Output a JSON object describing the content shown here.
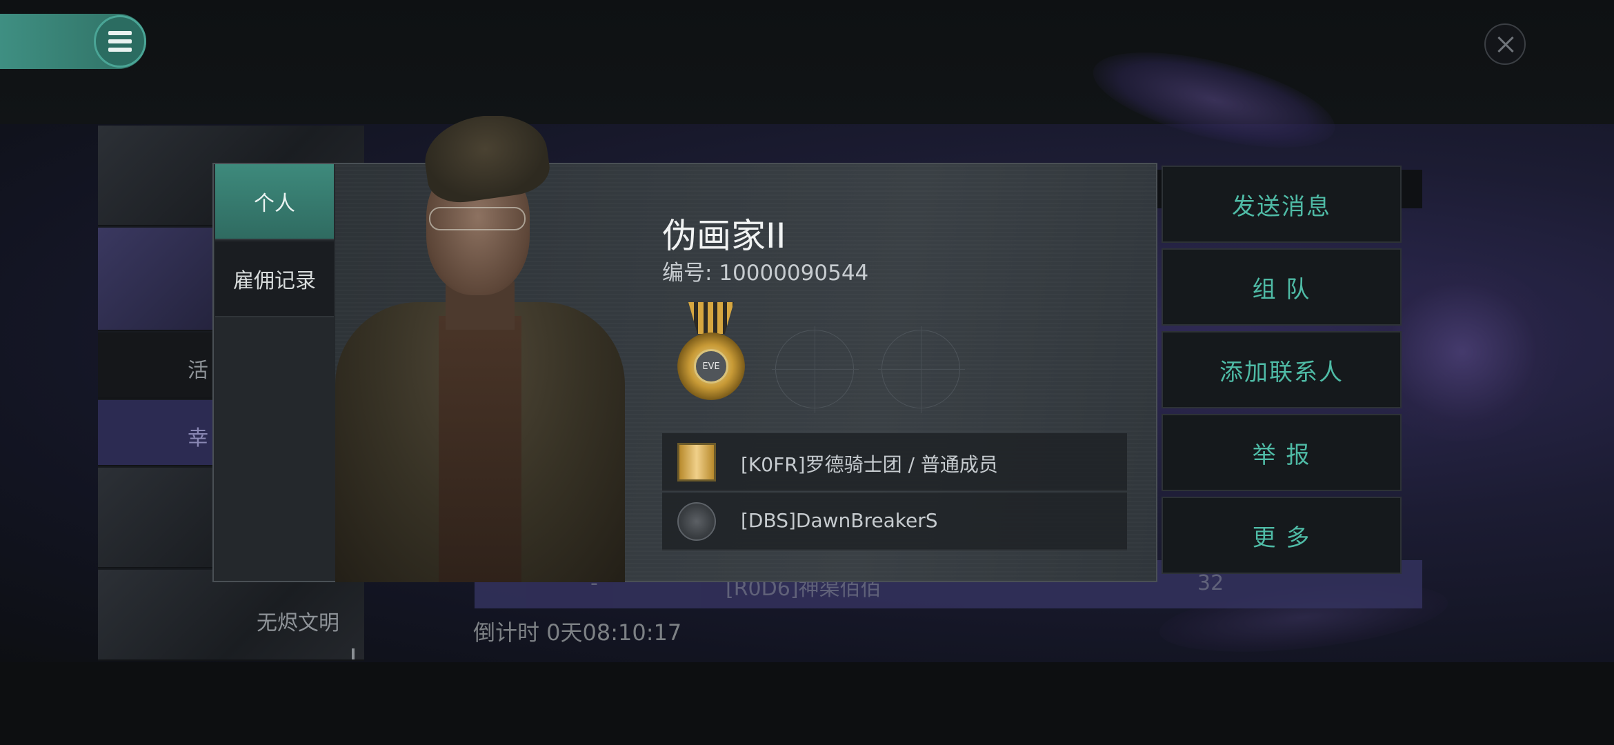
{
  "background": {
    "list_items": [
      "活",
      "幸",
      "无烬文明"
    ],
    "row": {
      "rank": "-",
      "name": "[R0D6]神渠佰佰",
      "value": "32"
    },
    "countdown": "倒计时 0天08:10:17"
  },
  "colors": {
    "accent": "#4fbba6",
    "tab_active": "#3e8a7c",
    "panel": "#353b40"
  },
  "icons": {
    "menu": "hamburger-menu-icon",
    "close": "close-icon"
  },
  "profile": {
    "tabs": [
      {
        "label": "个人",
        "active": true
      },
      {
        "label": "雇佣记录",
        "active": false
      }
    ],
    "name": "伪画家II",
    "id_label": "编号:",
    "id_value": "10000090544",
    "medal_text": "EVE",
    "corp": "[K0FR]罗德骑士团 / 普通成员",
    "alliance": "[DBS]DawnBreakerS"
  },
  "actions": [
    "发送消息",
    "组 队",
    "添加联系人",
    "举 报",
    "更 多"
  ]
}
